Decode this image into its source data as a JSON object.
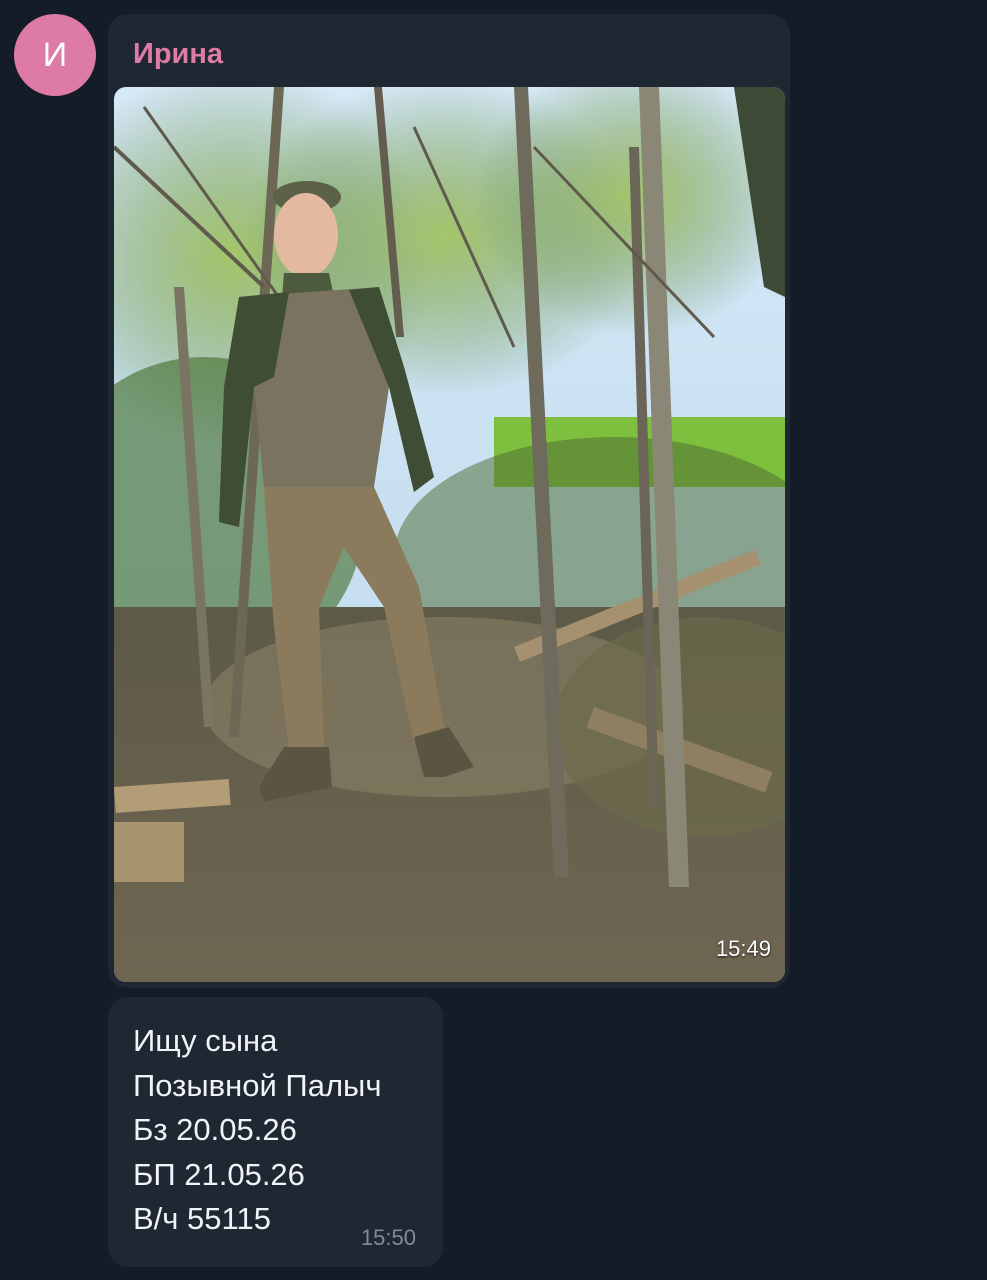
{
  "sender": {
    "avatar_letter": "И",
    "name": "Ирина",
    "avatar_color": "#dd7aa6",
    "name_color": "#de7ca7"
  },
  "photo_message": {
    "time": "15:49"
  },
  "text_message": {
    "lines": [
      "Ищу сына",
      "Позывной Палыч",
      "Бз 20.05.26",
      "БП 21.05.26",
      "В/ч 55115"
    ],
    "time": "15:50"
  },
  "colors": {
    "background": "#141d27",
    "bubble": "#1f2732",
    "text": "#f0f3f7",
    "time_text": "#7f8b99"
  }
}
